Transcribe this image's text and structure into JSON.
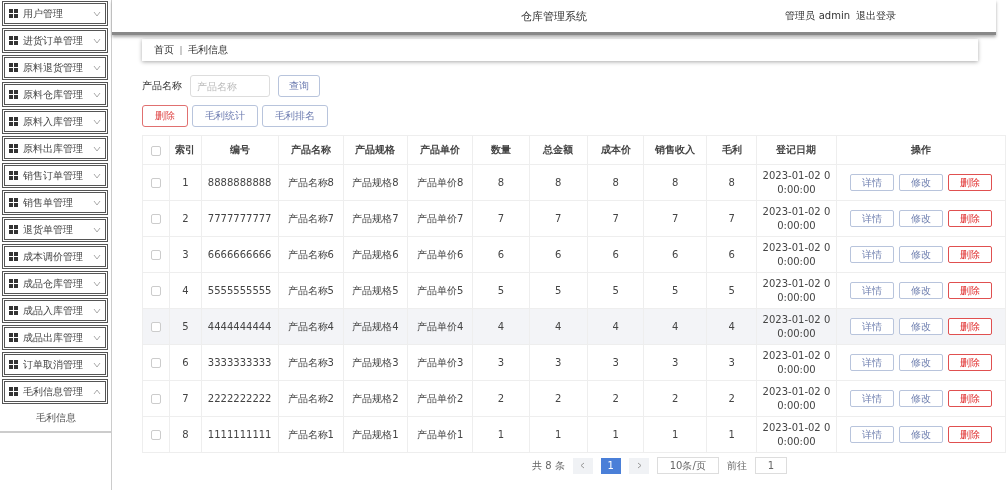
{
  "sidebar": {
    "items": [
      {
        "label": "用户管理",
        "expanded": false
      },
      {
        "label": "进货订单管理",
        "expanded": false
      },
      {
        "label": "原料退货管理",
        "expanded": false
      },
      {
        "label": "原料仓库管理",
        "expanded": false
      },
      {
        "label": "原料入库管理",
        "expanded": false
      },
      {
        "label": "原料出库管理",
        "expanded": false
      },
      {
        "label": "销售订单管理",
        "expanded": false
      },
      {
        "label": "销售单管理",
        "expanded": false
      },
      {
        "label": "退货单管理",
        "expanded": false
      },
      {
        "label": "成本调价管理",
        "expanded": false
      },
      {
        "label": "成品仓库管理",
        "expanded": false
      },
      {
        "label": "成品入库管理",
        "expanded": false
      },
      {
        "label": "成品出库管理",
        "expanded": false
      },
      {
        "label": "订单取消管理",
        "expanded": false
      },
      {
        "label": "毛利信息管理",
        "expanded": true,
        "children": [
          {
            "label": "毛利信息"
          }
        ]
      }
    ]
  },
  "header": {
    "title": "仓库管理系统",
    "user": "管理员 admin",
    "logout": "退出登录"
  },
  "breadcrumb": [
    "首页",
    "毛利信息"
  ],
  "search": {
    "label": "产品名称",
    "placeholder": "产品名称",
    "button": "查询"
  },
  "actions": [
    {
      "label": "删除",
      "kind": "danger"
    },
    {
      "label": "毛利统计",
      "kind": "plain"
    },
    {
      "label": "毛利排名",
      "kind": "plain"
    }
  ],
  "table": {
    "header_checked": false,
    "columns": [
      "索引",
      "编号",
      "产品名称",
      "产品规格",
      "产品单价",
      "数量",
      "总金额",
      "成本价",
      "销售收入",
      "毛利",
      "登记日期",
      "操作"
    ],
    "rows": [
      {
        "checked": false,
        "highlighted": false,
        "cells": [
          "1",
          "8888888888",
          "产品名称8",
          "产品规格8",
          "产品单价8",
          "8",
          "8",
          "8",
          "8",
          "8",
          "2023-01-02 00:00:00"
        ],
        "buttons": [
          "详情",
          "修改",
          "删除"
        ]
      },
      {
        "checked": false,
        "highlighted": false,
        "cells": [
          "2",
          "7777777777",
          "产品名称7",
          "产品规格7",
          "产品单价7",
          "7",
          "7",
          "7",
          "7",
          "7",
          "2023-01-02 00:00:00"
        ],
        "buttons": [
          "详情",
          "修改",
          "删除"
        ]
      },
      {
        "checked": false,
        "highlighted": false,
        "cells": [
          "3",
          "6666666666",
          "产品名称6",
          "产品规格6",
          "产品单价6",
          "6",
          "6",
          "6",
          "6",
          "6",
          "2023-01-02 00:00:00"
        ],
        "buttons": [
          "详情",
          "修改",
          "删除"
        ]
      },
      {
        "checked": false,
        "highlighted": false,
        "cells": [
          "4",
          "5555555555",
          "产品名称5",
          "产品规格5",
          "产品单价5",
          "5",
          "5",
          "5",
          "5",
          "5",
          "2023-01-02 00:00:00"
        ],
        "buttons": [
          "详情",
          "修改",
          "删除"
        ]
      },
      {
        "checked": false,
        "highlighted": true,
        "cells": [
          "5",
          "4444444444",
          "产品名称4",
          "产品规格4",
          "产品单价4",
          "4",
          "4",
          "4",
          "4",
          "4",
          "2023-01-02 00:00:00"
        ],
        "buttons": [
          "详情",
          "修改",
          "删除"
        ]
      },
      {
        "checked": false,
        "highlighted": false,
        "cells": [
          "6",
          "3333333333",
          "产品名称3",
          "产品规格3",
          "产品单价3",
          "3",
          "3",
          "3",
          "3",
          "3",
          "2023-01-02 00:00:00"
        ],
        "buttons": [
          "详情",
          "修改",
          "删除"
        ]
      },
      {
        "checked": false,
        "highlighted": false,
        "cells": [
          "7",
          "2222222222",
          "产品名称2",
          "产品规格2",
          "产品单价2",
          "2",
          "2",
          "2",
          "2",
          "2",
          "2023-01-02 00:00:00"
        ],
        "buttons": [
          "详情",
          "修改",
          "删除"
        ]
      },
      {
        "checked": false,
        "highlighted": false,
        "cells": [
          "8",
          "1111111111",
          "产品名称1",
          "产品规格1",
          "产品单价1",
          "1",
          "1",
          "1",
          "1",
          "1",
          "2023-01-02 00:00:00"
        ],
        "buttons": [
          "详情",
          "修改",
          "删除"
        ]
      }
    ]
  },
  "pagination": {
    "total": "共 8 条",
    "pages": [
      {
        "label": "1",
        "selected": true
      }
    ],
    "page_size": "10条/页",
    "goto": "前往",
    "goto_value": "1"
  }
}
